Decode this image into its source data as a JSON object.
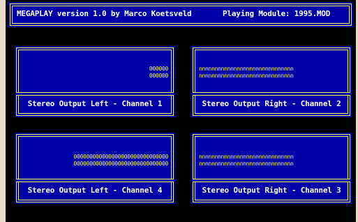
{
  "title_bar": {
    "left": "MEGAPLAY version 1.0 by Marco Koetsveld",
    "right": "Playing Module: 1995.MOD"
  },
  "panels": {
    "ch1": {
      "label": "Stereo Output Left  - Channel 1",
      "viz": "000000\n000000"
    },
    "ch2": {
      "label": "Stereo Output Right - Channel 2",
      "viz": "nnnnnnnnnnnnnnnnnnnnnnnnnnnnnn\nnnnnnnnnnnnnnnnnnnnnnnnnnnnnnn"
    },
    "ch4": {
      "label": "Stereo Output Left  - Channel 4",
      "viz": "000000000000000000000000000000\n000000000000000000000000000000"
    },
    "ch3": {
      "label": "Stereo Output Right - Channel 3",
      "viz": "nnnnnnnnnnnnnnnnnnnnnnnnnnnnnn\nnnnnnnnnnnnnnnnnnnnnnnnnnnnnnn"
    }
  },
  "colors": {
    "background": "#000000",
    "panel": "#0000a8",
    "frame": "#fcfc54",
    "text": "#ffffff",
    "viz": "#fcfc54"
  }
}
